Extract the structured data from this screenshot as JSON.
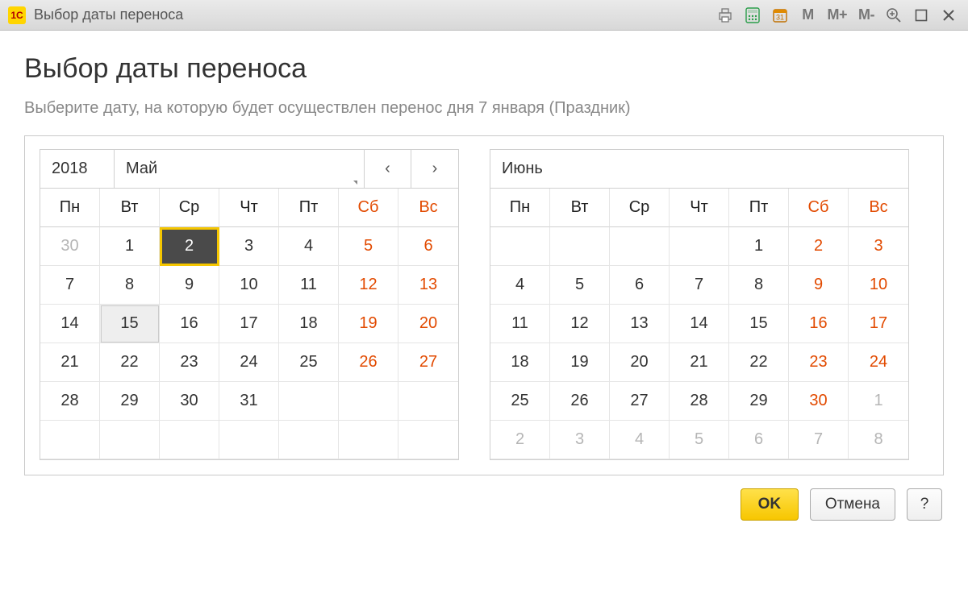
{
  "titlebar": {
    "app_logo_text": "1C",
    "title": "Выбор даты переноса",
    "buttons": {
      "m": "M",
      "mplus": "M+",
      "mminus": "M-"
    }
  },
  "page": {
    "title": "Выбор даты переноса",
    "subtitle": "Выберите дату, на которую будет осуществлен перенос дня 7 января (Праздник)"
  },
  "dow": [
    "Пн",
    "Вт",
    "Ср",
    "Чт",
    "Пт",
    "Сб",
    "Вс"
  ],
  "nav": {
    "prev": "‹",
    "next": "›"
  },
  "calendars": [
    {
      "year": "2018",
      "month": "Май",
      "show_year": true,
      "show_nav": true,
      "rows": [
        [
          {
            "d": "30",
            "other": true
          },
          {
            "d": "1"
          },
          {
            "d": "2",
            "selected": true
          },
          {
            "d": "3"
          },
          {
            "d": "4"
          },
          {
            "d": "5",
            "wk": true
          },
          {
            "d": "6",
            "wk": true
          }
        ],
        [
          {
            "d": "7"
          },
          {
            "d": "8"
          },
          {
            "d": "9"
          },
          {
            "d": "10"
          },
          {
            "d": "11"
          },
          {
            "d": "12",
            "wk": true
          },
          {
            "d": "13",
            "wk": true
          }
        ],
        [
          {
            "d": "14"
          },
          {
            "d": "15",
            "hover": true
          },
          {
            "d": "16"
          },
          {
            "d": "17"
          },
          {
            "d": "18"
          },
          {
            "d": "19",
            "wk": true
          },
          {
            "d": "20",
            "wk": true
          }
        ],
        [
          {
            "d": "21"
          },
          {
            "d": "22"
          },
          {
            "d": "23"
          },
          {
            "d": "24"
          },
          {
            "d": "25"
          },
          {
            "d": "26",
            "wk": true
          },
          {
            "d": "27",
            "wk": true
          }
        ],
        [
          {
            "d": "28"
          },
          {
            "d": "29"
          },
          {
            "d": "30"
          },
          {
            "d": "31"
          },
          {
            "d": ""
          },
          {
            "d": ""
          },
          {
            "d": ""
          }
        ],
        [
          {
            "d": ""
          },
          {
            "d": ""
          },
          {
            "d": ""
          },
          {
            "d": ""
          },
          {
            "d": ""
          },
          {
            "d": ""
          },
          {
            "d": ""
          }
        ]
      ]
    },
    {
      "year": "",
      "month": "Июнь",
      "show_year": false,
      "show_nav": false,
      "rows": [
        [
          {
            "d": ""
          },
          {
            "d": ""
          },
          {
            "d": ""
          },
          {
            "d": ""
          },
          {
            "d": "1"
          },
          {
            "d": "2",
            "wk": true
          },
          {
            "d": "3",
            "wk": true
          }
        ],
        [
          {
            "d": "4"
          },
          {
            "d": "5"
          },
          {
            "d": "6"
          },
          {
            "d": "7"
          },
          {
            "d": "8"
          },
          {
            "d": "9",
            "wk": true
          },
          {
            "d": "10",
            "wk": true
          }
        ],
        [
          {
            "d": "11"
          },
          {
            "d": "12"
          },
          {
            "d": "13"
          },
          {
            "d": "14"
          },
          {
            "d": "15"
          },
          {
            "d": "16",
            "wk": true
          },
          {
            "d": "17",
            "wk": true
          }
        ],
        [
          {
            "d": "18"
          },
          {
            "d": "19"
          },
          {
            "d": "20"
          },
          {
            "d": "21"
          },
          {
            "d": "22"
          },
          {
            "d": "23",
            "wk": true
          },
          {
            "d": "24",
            "wk": true
          }
        ],
        [
          {
            "d": "25"
          },
          {
            "d": "26"
          },
          {
            "d": "27"
          },
          {
            "d": "28"
          },
          {
            "d": "29"
          },
          {
            "d": "30",
            "wk": true
          },
          {
            "d": "1",
            "other": true
          }
        ],
        [
          {
            "d": "2",
            "other": true
          },
          {
            "d": "3",
            "other": true
          },
          {
            "d": "4",
            "other": true
          },
          {
            "d": "5",
            "other": true
          },
          {
            "d": "6",
            "other": true
          },
          {
            "d": "7",
            "other": true
          },
          {
            "d": "8",
            "other": true
          }
        ]
      ]
    }
  ],
  "footer": {
    "ok": "OK",
    "cancel": "Отмена",
    "help": "?"
  }
}
